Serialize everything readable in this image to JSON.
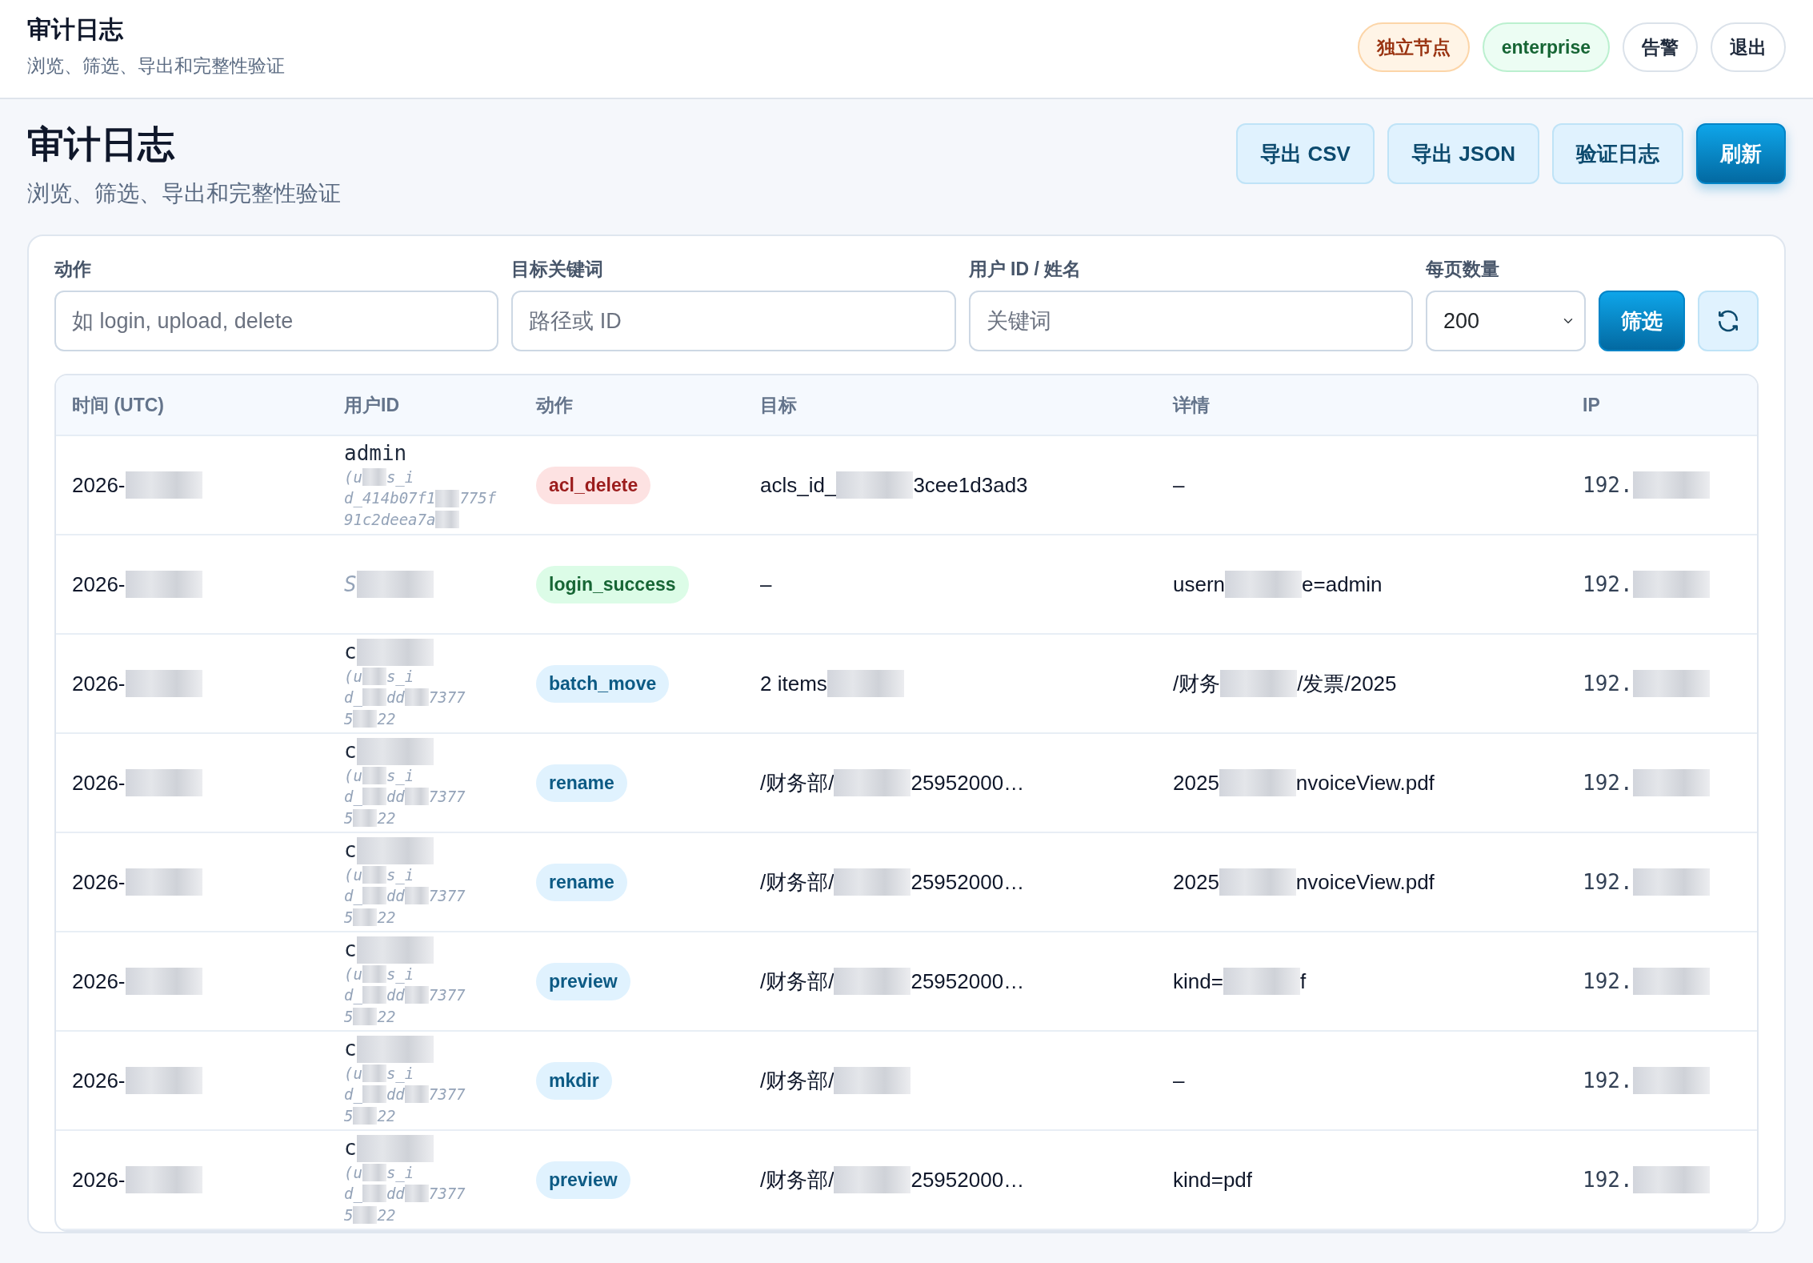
{
  "topbar": {
    "title": "审计日志",
    "subtitle": "浏览、筛选、导出和完整性验证",
    "pills": [
      {
        "label": "独立节点",
        "kind": "warning"
      },
      {
        "label": "enterprise",
        "kind": "success"
      },
      {
        "label": "告警",
        "kind": "plain"
      },
      {
        "label": "退出",
        "kind": "plain"
      }
    ]
  },
  "page": {
    "title": "审计日志",
    "subtitle": "浏览、筛选、导出和完整性验证",
    "actions": [
      {
        "label": "导出 CSV",
        "kind": "soft"
      },
      {
        "label": "导出 JSON",
        "kind": "soft"
      },
      {
        "label": "验证日志",
        "kind": "soft"
      },
      {
        "label": "刷新",
        "kind": "primary"
      }
    ]
  },
  "filters": {
    "fields": [
      {
        "label": "动作",
        "placeholder": "如 login, upload, delete"
      },
      {
        "label": "目标关键词",
        "placeholder": "路径或 ID"
      },
      {
        "label": "用户 ID / 姓名",
        "placeholder": "关键词"
      }
    ],
    "page_size": {
      "label": "每页数量",
      "value": "200"
    },
    "filter_button": "筛选"
  },
  "table": {
    "columns": [
      "时间 (UTC)",
      "用户ID",
      "动作",
      "目标",
      "详情",
      "IP"
    ],
    "rows": [
      {
        "time": {
          "parts": [
            "2026-"
          ],
          "tail": true
        },
        "user": {
          "name": "admin",
          "muted": false,
          "name_tail": false,
          "id_lines": [
            {
              "parts": [
                "(u",
                "s_i"
              ],
              "tail": false
            },
            {
              "parts": [
                "d_414b07f1",
                "775f"
              ],
              "tail": false
            },
            {
              "parts": [
                "91c2deea7a"
              ],
              "tail": true
            }
          ]
        },
        "action": {
          "label": "acl_delete",
          "kind": "danger"
        },
        "target": {
          "parts": [
            "acls_id_",
            "3cee1d3ad3"
          ],
          "tail": false
        },
        "details": {
          "parts": [
            "–"
          ],
          "tail": false
        },
        "ip": {
          "parts": [
            "192."
          ],
          "tail": true
        }
      },
      {
        "time": {
          "parts": [
            "2026-"
          ],
          "tail": true
        },
        "user": {
          "name": "S",
          "muted": true,
          "name_tail": true
        },
        "action": {
          "label": "login_success",
          "kind": "success"
        },
        "target": {
          "parts": [
            "–"
          ],
          "tail": false
        },
        "details": {
          "parts": [
            "usern",
            "e=admin"
          ],
          "tail": false
        },
        "ip": {
          "parts": [
            "192."
          ],
          "tail": true
        }
      },
      {
        "time": {
          "parts": [
            "2026-"
          ],
          "tail": true
        },
        "user": {
          "name": "c",
          "muted": false,
          "name_tail": true,
          "id_lines": [
            {
              "parts": [
                "(u",
                "s_i"
              ],
              "tail": false
            },
            {
              "parts": [
                "d_",
                "dd",
                "7377"
              ],
              "tail": false
            },
            {
              "parts": [
                "5",
                "22"
              ],
              "tail": false
            }
          ]
        },
        "action": {
          "label": "batch_move",
          "kind": "info"
        },
        "target": {
          "parts": [
            "2 items"
          ],
          "tail": true
        },
        "details": {
          "parts": [
            "/财务",
            "/发票/2025"
          ],
          "tail": false
        },
        "ip": {
          "parts": [
            "192."
          ],
          "tail": true
        }
      },
      {
        "time": {
          "parts": [
            "2026-"
          ],
          "tail": true
        },
        "user": {
          "name": "c",
          "muted": false,
          "name_tail": true,
          "id_lines": [
            {
              "parts": [
                "(u",
                "s_i"
              ],
              "tail": false
            },
            {
              "parts": [
                "d_",
                "dd",
                "7377"
              ],
              "tail": false
            },
            {
              "parts": [
                "5",
                "22"
              ],
              "tail": false
            }
          ]
        },
        "action": {
          "label": "rename",
          "kind": "info"
        },
        "target": {
          "parts": [
            "/财务部/",
            "25952000…"
          ],
          "tail": false
        },
        "details": {
          "parts": [
            "2025",
            "nvoiceView.pdf"
          ],
          "tail": false
        },
        "ip": {
          "parts": [
            "192."
          ],
          "tail": true
        }
      },
      {
        "time": {
          "parts": [
            "2026-"
          ],
          "tail": true
        },
        "user": {
          "name": "c",
          "muted": false,
          "name_tail": true,
          "id_lines": [
            {
              "parts": [
                "(u",
                "s_i"
              ],
              "tail": false
            },
            {
              "parts": [
                "d_",
                "dd",
                "7377"
              ],
              "tail": false
            },
            {
              "parts": [
                "5",
                "22"
              ],
              "tail": false
            }
          ]
        },
        "action": {
          "label": "rename",
          "kind": "info"
        },
        "target": {
          "parts": [
            "/财务部/",
            "25952000…"
          ],
          "tail": false
        },
        "details": {
          "parts": [
            "2025",
            "nvoiceView.pdf"
          ],
          "tail": false
        },
        "ip": {
          "parts": [
            "192."
          ],
          "tail": true
        }
      },
      {
        "time": {
          "parts": [
            "2026-"
          ],
          "tail": true
        },
        "user": {
          "name": "c",
          "muted": false,
          "name_tail": true,
          "id_lines": [
            {
              "parts": [
                "(u",
                "s_i"
              ],
              "tail": false
            },
            {
              "parts": [
                "d_",
                "dd",
                "7377"
              ],
              "tail": false
            },
            {
              "parts": [
                "5",
                "22"
              ],
              "tail": false
            }
          ]
        },
        "action": {
          "label": "preview",
          "kind": "info"
        },
        "target": {
          "parts": [
            "/财务部/",
            "25952000…"
          ],
          "tail": false
        },
        "details": {
          "parts": [
            "kind=",
            "f"
          ],
          "tail": false
        },
        "ip": {
          "parts": [
            "192."
          ],
          "tail": true
        }
      },
      {
        "time": {
          "parts": [
            "2026-"
          ],
          "tail": true
        },
        "user": {
          "name": "c",
          "muted": false,
          "name_tail": true,
          "id_lines": [
            {
              "parts": [
                "(u",
                "s_i"
              ],
              "tail": false
            },
            {
              "parts": [
                "d_",
                "dd",
                "7377"
              ],
              "tail": false
            },
            {
              "parts": [
                "5",
                "22"
              ],
              "tail": false
            }
          ]
        },
        "action": {
          "label": "mkdir",
          "kind": "info"
        },
        "target": {
          "parts": [
            "/财务部/"
          ],
          "tail": true
        },
        "details": {
          "parts": [
            "–"
          ],
          "tail": false
        },
        "ip": {
          "parts": [
            "192."
          ],
          "tail": true
        }
      },
      {
        "time": {
          "parts": [
            "2026-"
          ],
          "tail": true
        },
        "user": {
          "name": "c",
          "muted": false,
          "name_tail": true,
          "id_lines": [
            {
              "parts": [
                "(u",
                "s_i"
              ],
              "tail": false
            },
            {
              "parts": [
                "d_",
                "dd",
                "7377"
              ],
              "tail": false
            },
            {
              "parts": [
                "5",
                "22"
              ],
              "tail": false
            }
          ]
        },
        "action": {
          "label": "preview",
          "kind": "info"
        },
        "target": {
          "parts": [
            "/财务部/",
            "25952000…"
          ],
          "tail": false
        },
        "details": {
          "parts": [
            "kind=pdf"
          ],
          "tail": false
        },
        "ip": {
          "parts": [
            "192."
          ],
          "tail": true
        }
      }
    ]
  }
}
